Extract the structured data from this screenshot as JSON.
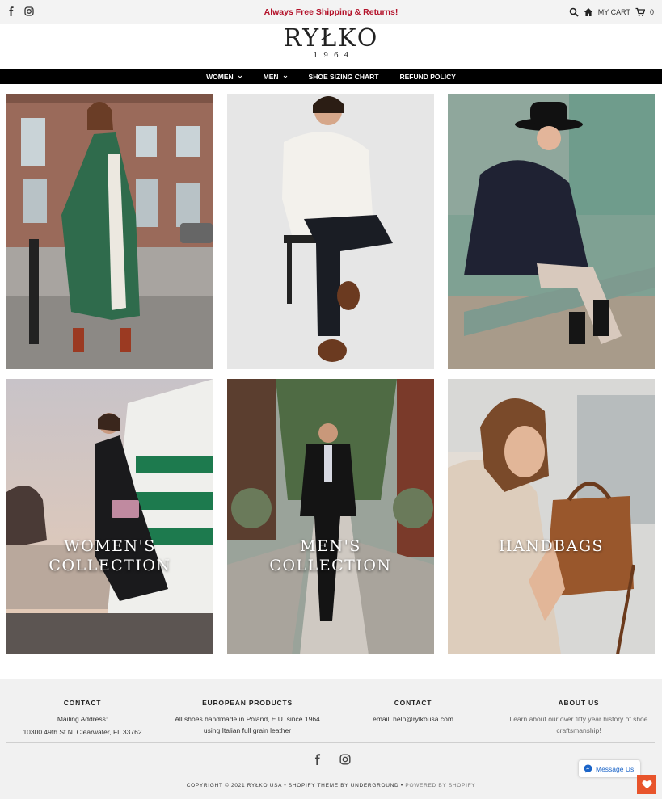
{
  "topbar": {
    "promo": "Always Free Shipping & Returns!",
    "cart_label": "MY CART",
    "cart_count": "0",
    "icons": [
      "facebook-icon",
      "instagram-icon",
      "search-icon",
      "home-icon",
      "cart-icon"
    ]
  },
  "logo": {
    "brand": "RYŁKO",
    "year": "1964"
  },
  "nav": {
    "items": [
      {
        "label": "WOMEN",
        "dropdown": true
      },
      {
        "label": "MEN",
        "dropdown": true
      },
      {
        "label": "SHOE SIZING CHART",
        "dropdown": false
      },
      {
        "label": "REFUND POLICY",
        "dropdown": false
      }
    ]
  },
  "tiles": [
    {
      "caption": "",
      "photo": "woman-in-green-coat-street"
    },
    {
      "caption": "",
      "photo": "man-in-white-sweater-on-stool"
    },
    {
      "caption": "",
      "photo": "woman-in-hat-sitting-on-step"
    },
    {
      "caption_line1": "WOMEN'S",
      "caption_line2": "COLLECTION",
      "photo": "woman-in-black-dress-seaside"
    },
    {
      "caption_line1": "MEN'S",
      "caption_line2": "COLLECTION",
      "photo": "man-in-suit-walking"
    },
    {
      "caption_line1": "HANDBAGS",
      "caption_line2": "",
      "photo": "woman-with-brown-handbag"
    }
  ],
  "footer": {
    "col1": {
      "title": "CONTACT",
      "line1": "Mailing Address:",
      "line2": "10300 49th St N. Clearwater, FL 33762"
    },
    "col2": {
      "title": "EUROPEAN PRODUCTS",
      "line1": "All shoes handmade in Poland, E.U. since 1964",
      "line2": "using Italian full grain leather"
    },
    "col3": {
      "title": "CONTACT",
      "line1": "email: help@rylkousa.com"
    },
    "col4": {
      "title": "ABOUT US",
      "line1": "Learn about our over fifty year history of shoe",
      "line2": "craftsmanship!"
    },
    "copyright": "COPYRIGHT © 2021 RYŁKO USA • SHOPIFY THEME BY UNDERGROUND •",
    "powered": "POWERED BY SHOPIFY"
  },
  "messenger": {
    "label": "Message Us"
  },
  "colors": {
    "promo": "#b3122a",
    "nav_bg": "#000000",
    "heart_bg": "#e8542b",
    "messenger": "#1a64c8"
  }
}
